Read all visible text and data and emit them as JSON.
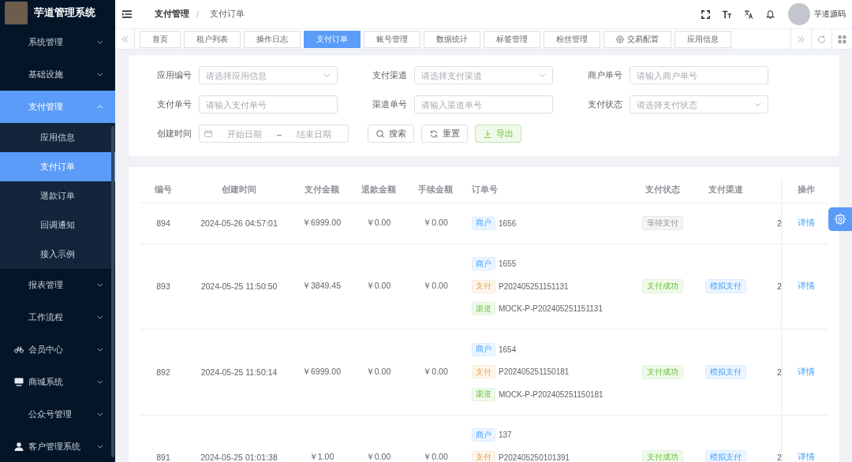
{
  "sidebar": {
    "title": "芋道管理系统",
    "items": [
      {
        "label": "系统管理",
        "selected": false,
        "expanded": false
      },
      {
        "label": "基础设施",
        "selected": false,
        "expanded": false
      },
      {
        "label": "支付管理",
        "selected": true,
        "expanded": true,
        "children": [
          {
            "label": "应用信息",
            "selected": false
          },
          {
            "label": "支付订单",
            "selected": true
          },
          {
            "label": "退款订单",
            "selected": false
          },
          {
            "label": "回调通知",
            "selected": false
          },
          {
            "label": "接入示例",
            "selected": false
          }
        ]
      },
      {
        "label": "报表管理",
        "selected": false,
        "expanded": false
      },
      {
        "label": "工作流程",
        "selected": false,
        "expanded": false
      },
      {
        "label": "会员中心",
        "selected": false,
        "expanded": false
      },
      {
        "label": "商城系统",
        "selected": false,
        "expanded": false
      },
      {
        "label": "公众号管理",
        "selected": false,
        "expanded": false
      },
      {
        "label": "客户管理系统",
        "selected": false,
        "expanded": false
      }
    ]
  },
  "header": {
    "breadcrumb": [
      "支付管理",
      "支付订单"
    ],
    "separator": "/",
    "user_name": "芋道源码"
  },
  "tabs": [
    {
      "label": "首页",
      "selected": false
    },
    {
      "label": "租户列表",
      "selected": false
    },
    {
      "label": "操作日志",
      "selected": false
    },
    {
      "label": "支付订单",
      "selected": true
    },
    {
      "label": "账号管理",
      "selected": false
    },
    {
      "label": "数据统计",
      "selected": false
    },
    {
      "label": "标签管理",
      "selected": false
    },
    {
      "label": "粉丝管理",
      "selected": false
    },
    {
      "label": "交易配置",
      "selected": false
    },
    {
      "label": "应用信息",
      "selected": false
    }
  ],
  "search_form": {
    "fields": [
      {
        "kind": "select",
        "label": "应用编号",
        "placeholder": "请选择应用信息"
      },
      {
        "kind": "select",
        "label": "支付渠道",
        "placeholder": "请选择支付渠道"
      },
      {
        "kind": "input",
        "label": "商户单号",
        "placeholder": "请输入商户单号"
      },
      {
        "kind": "input",
        "label": "支付单号",
        "placeholder": "请输入支付单号"
      },
      {
        "kind": "input",
        "label": "渠道单号",
        "placeholder": "请输入渠道单号"
      },
      {
        "kind": "select",
        "label": "支付状态",
        "placeholder": "请选择支付状态"
      },
      {
        "kind": "daterange",
        "label": "创建时间",
        "start_placeholder": "开始日期",
        "separator": "–",
        "end_placeholder": "结束日期"
      }
    ],
    "buttons": [
      {
        "kind": "search",
        "label": "搜索"
      },
      {
        "kind": "reset",
        "label": "重置"
      },
      {
        "kind": "export",
        "label": "导出"
      }
    ]
  },
  "table": {
    "columns": [
      "编号",
      "创建时间",
      "支付金额",
      "退款金额",
      "手续金额",
      "订单号",
      "支付状态",
      "支付渠道",
      "操作"
    ],
    "rows": [
      {
        "id": "894",
        "created": "2024-05-26 04:57:01",
        "pay_amount": "￥6999.00",
        "refund_amount": "￥0.00",
        "fee_amount": "￥0.00",
        "order_no": [
          {
            "kind": "merchant",
            "tag": "商户",
            "value": "1656"
          }
        ],
        "status": {
          "kind": "waiting",
          "label": "等待支付"
        },
        "column_9": "2",
        "action": "详情"
      },
      {
        "id": "893",
        "created": "2024-05-25 11:50:50",
        "pay_amount": "￥3849.45",
        "refund_amount": "￥0.00",
        "fee_amount": "￥0.00",
        "order_no": [
          {
            "kind": "merchant",
            "tag": "商户",
            "value": "1655"
          },
          {
            "kind": "pay",
            "tag": "支付",
            "value": "P202405251151131"
          },
          {
            "kind": "channel",
            "tag": "渠道",
            "value": "MOCK-P-P202405251151131"
          }
        ],
        "status": {
          "kind": "success",
          "label": "支付成功"
        },
        "channel": "模拟支付",
        "column_9": "2",
        "action": "详情"
      },
      {
        "id": "892",
        "created": "2024-05-25 11:50:14",
        "pay_amount": "￥6999.00",
        "refund_amount": "￥0.00",
        "fee_amount": "￥0.00",
        "order_no": [
          {
            "kind": "merchant",
            "tag": "商户",
            "value": "1654"
          },
          {
            "kind": "pay",
            "tag": "支付",
            "value": "P202405251150181"
          },
          {
            "kind": "channel",
            "tag": "渠道",
            "value": "MOCK-P-P202405251150181"
          }
        ],
        "status": {
          "kind": "success",
          "label": "支付成功"
        },
        "channel": "模拟支付",
        "column_9": "2",
        "action": "详情"
      },
      {
        "id": "891",
        "created": "2024-05-25 01:01:38",
        "pay_amount": "￥1.00",
        "refund_amount": "￥0.00",
        "fee_amount": "￥0.00",
        "order_no": [
          {
            "kind": "merchant",
            "tag": "商户",
            "value": "137"
          },
          {
            "kind": "pay",
            "tag": "支付",
            "value": "P202405250101391"
          }
        ],
        "status": {
          "kind": "success",
          "label": "支付成功"
        },
        "channel": "模拟支付",
        "column_9": "2",
        "action": "详情"
      }
    ]
  }
}
